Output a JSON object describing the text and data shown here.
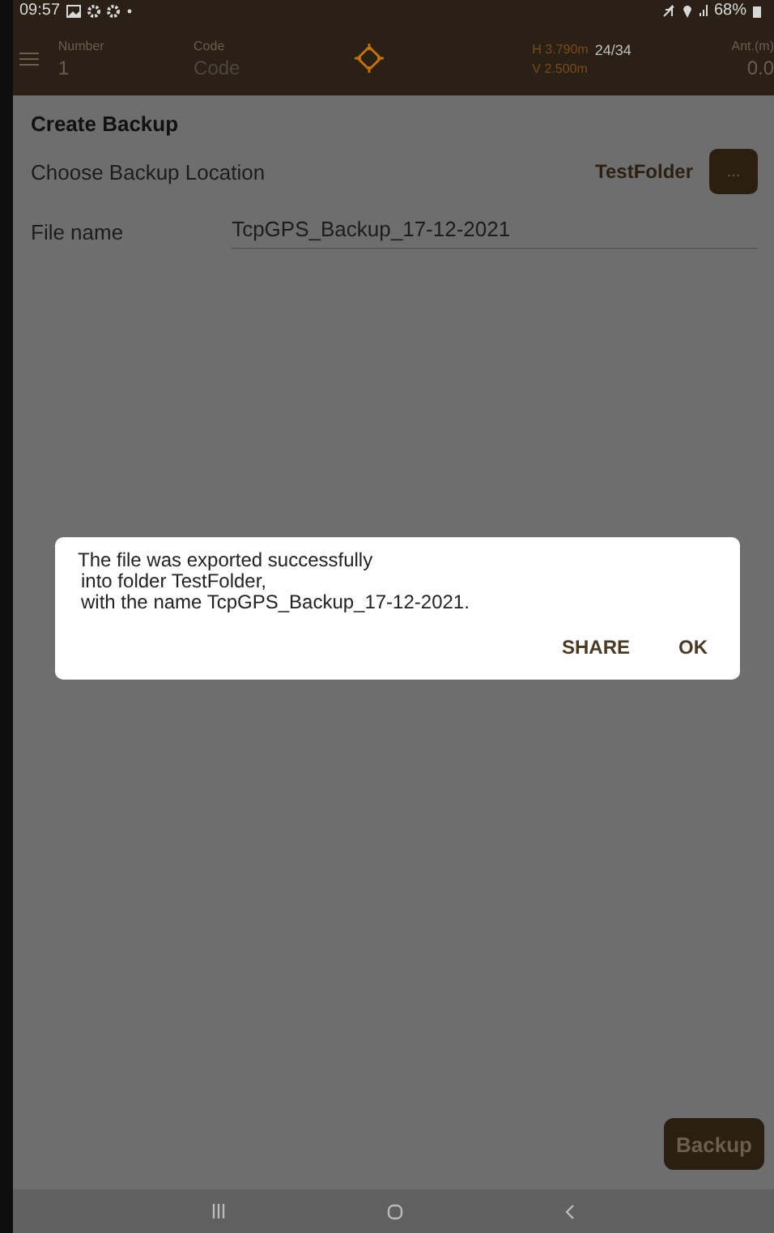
{
  "status_bar": {
    "time": "09:57",
    "battery": "68%"
  },
  "header": {
    "number_label": "Number",
    "number_value": "1",
    "code_label": "Code",
    "code_placeholder": "Code",
    "h_reading": "H 3.790m",
    "satellites": "24/34",
    "v_reading": "V 2.500m",
    "antenna_label": "Ant.(m)",
    "antenna_value": "0.0"
  },
  "page": {
    "title": "Create Backup",
    "location_label": "Choose Backup Location",
    "location_value": "TestFolder",
    "browse_button": "...",
    "file_name_label": "File name",
    "file_name_value": "TcpGPS_Backup_17-12-2021",
    "backup_button": "Backup"
  },
  "dialog": {
    "lines": [
      "The file was exported successfully",
      "into folder TestFolder,",
      "with the name TcpGPS_Backup_17-12-2021."
    ],
    "buttons": [
      "SHARE",
      "OK"
    ]
  }
}
